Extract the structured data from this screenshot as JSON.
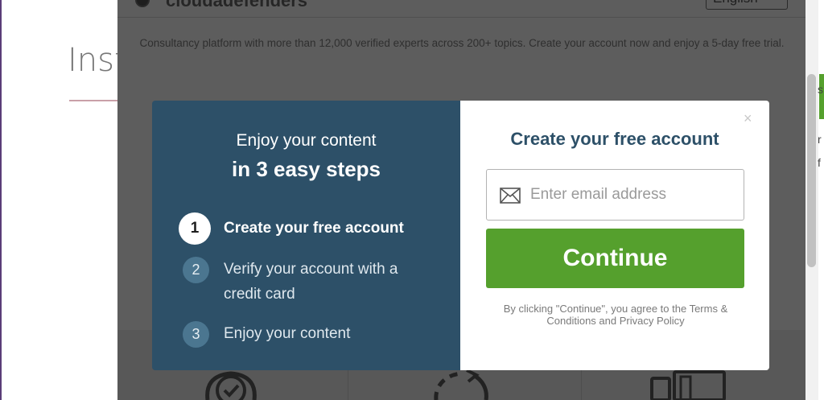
{
  "background": {
    "left_title": "Inst",
    "right_fragments": [
      "s",
      "r",
      "f"
    ]
  },
  "outer_dialog": {
    "brand_name": "cloudadefenders",
    "language": "English",
    "tagline": "Consultancy platform with more than 12,000 verified experts across 200+ topics. Create your account now and enjoy a 5-day free trial."
  },
  "modal": {
    "steps_heading_line1": "Enjoy your content",
    "steps_heading_line2": "in 3 easy steps",
    "steps": [
      {
        "number": "1",
        "label": "Create your free account",
        "active": true
      },
      {
        "number": "2",
        "label": "Verify your account with a credit card",
        "active": false
      },
      {
        "number": "3",
        "label": "Enjoy your content",
        "active": false
      }
    ],
    "close_symbol": "×",
    "form_title": "Create your free account",
    "email_placeholder": "Enter email address",
    "email_value": "",
    "continue_label": "Continue",
    "legal_text": "By clicking \"Continue\", you agree to the Terms & Conditions and Privacy Policy"
  },
  "colors": {
    "left_panel": "#2d5068",
    "accent_green": "#55a02d",
    "title_blue": "#2d5068",
    "overlay": "#5d5d5d"
  },
  "icons": {
    "email": "envelope-icon",
    "close": "close-icon",
    "feature_1": "checkmark-badge-icon",
    "feature_2": "refresh-arrows-icon",
    "feature_3": "devices-icon"
  }
}
